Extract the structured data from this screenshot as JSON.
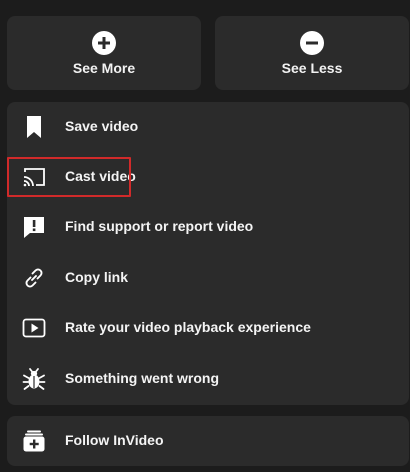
{
  "top_actions": {
    "see_more": {
      "label": "See More",
      "icon": "plus-circle-icon"
    },
    "see_less": {
      "label": "See Less",
      "icon": "minus-circle-icon"
    }
  },
  "menu": {
    "items": [
      {
        "label": "Save video",
        "icon": "bookmark-icon"
      },
      {
        "label": "Cast video",
        "icon": "cast-icon"
      },
      {
        "label": "Find support or report video",
        "icon": "report-icon"
      },
      {
        "label": "Copy link",
        "icon": "link-icon",
        "highlighted": true
      },
      {
        "label": "Rate your video playback experience",
        "icon": "play-rate-icon"
      },
      {
        "label": "Something went wrong",
        "icon": "bug-icon"
      }
    ]
  },
  "follow": {
    "label": "Follow InVideo",
    "icon": "follow-icon"
  },
  "colors": {
    "background": "#1c1c1c",
    "card": "#2b2b2b",
    "highlight": "#d12a2a",
    "text": "#ffffff"
  }
}
